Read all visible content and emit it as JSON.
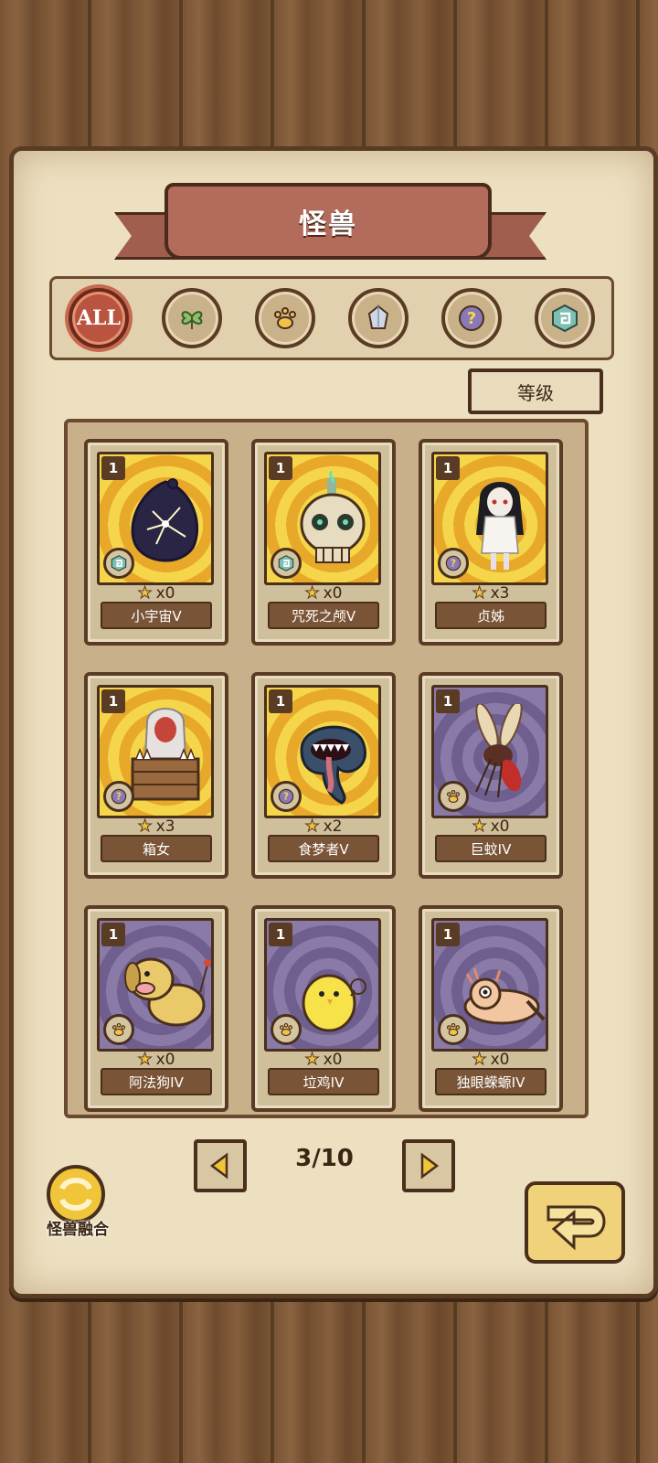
{
  "title": "怪兽",
  "filters": [
    {
      "label": "ALL",
      "icon": "all-icon",
      "active": true
    },
    {
      "label": "",
      "icon": "leaf-icon",
      "active": false
    },
    {
      "label": "",
      "icon": "paw-icon",
      "active": false
    },
    {
      "label": "",
      "icon": "crystal-icon",
      "active": false
    },
    {
      "label": "",
      "icon": "question-icon",
      "active": false
    },
    {
      "label": "",
      "icon": "rune-icon",
      "active": false
    }
  ],
  "sort_label": "等级",
  "cards": [
    {
      "level": "1",
      "count": "x0",
      "name": "小宇宙V",
      "bg": "gold",
      "type": "rune-icon",
      "creature": "cosmic-orb"
    },
    {
      "level": "1",
      "count": "x0",
      "name": "咒死之颅V",
      "bg": "gold",
      "type": "rune-icon",
      "creature": "skull-candle"
    },
    {
      "level": "1",
      "count": "x3",
      "name": "贞姊",
      "bg": "gold",
      "type": "question-icon",
      "creature": "ghost-girl"
    },
    {
      "level": "1",
      "count": "x3",
      "name": "箱女",
      "bg": "gold",
      "type": "question-icon",
      "creature": "box-woman"
    },
    {
      "level": "1",
      "count": "x2",
      "name": "食梦者V",
      "bg": "gold",
      "type": "question-icon",
      "creature": "dream-eater"
    },
    {
      "level": "1",
      "count": "x0",
      "name": "巨蚊IV",
      "bg": "purple",
      "type": "paw-icon",
      "creature": "giant-mosquito"
    },
    {
      "level": "1",
      "count": "x0",
      "name": "阿法狗IV",
      "bg": "purple",
      "type": "paw-icon",
      "creature": "dog"
    },
    {
      "level": "1",
      "count": "x0",
      "name": "垃鸡IV",
      "bg": "purple",
      "type": "paw-icon",
      "creature": "chick"
    },
    {
      "level": "1",
      "count": "x0",
      "name": "独眼蝾螈IV",
      "bg": "purple",
      "type": "paw-icon",
      "creature": "salamander"
    }
  ],
  "pagination": {
    "current": "3/10"
  },
  "fusion_label": "怪兽融合",
  "colors": {
    "ribbon": "#b36b5c",
    "panel": "#ede0c0",
    "wood": "#7a5535"
  }
}
